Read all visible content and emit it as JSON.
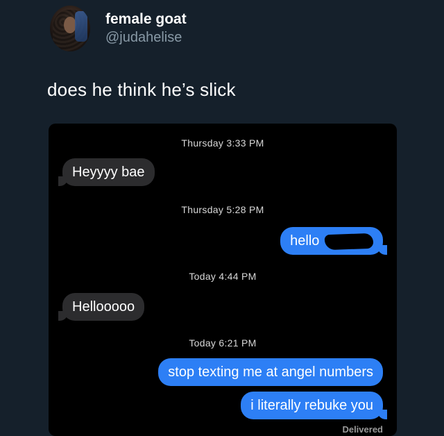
{
  "author": {
    "display_name": "female goat",
    "handle": "@judahelise",
    "avatar_icon": "profile-photo-icon"
  },
  "tweet": {
    "text": "does he think he’s slick"
  },
  "conversation": {
    "timestamps": [
      "Thursday 3:33 PM",
      "Thursday 5:28 PM",
      "Today 4:44 PM",
      "Today 6:21 PM"
    ],
    "messages": [
      {
        "direction": "incoming",
        "text": "Heyyyy bae"
      },
      {
        "direction": "outgoing",
        "text": "hello"
      },
      {
        "direction": "incoming",
        "text": "Hellooooo"
      },
      {
        "direction": "outgoing",
        "text": "stop texting me at angel numbers"
      },
      {
        "direction": "outgoing",
        "text": "i literally rebuke you"
      }
    ],
    "status": "Delivered"
  },
  "colors": {
    "background": "#15202b",
    "incoming_bubble": "#2c2c2e",
    "outgoing_bubble": "#2d7ff5"
  }
}
